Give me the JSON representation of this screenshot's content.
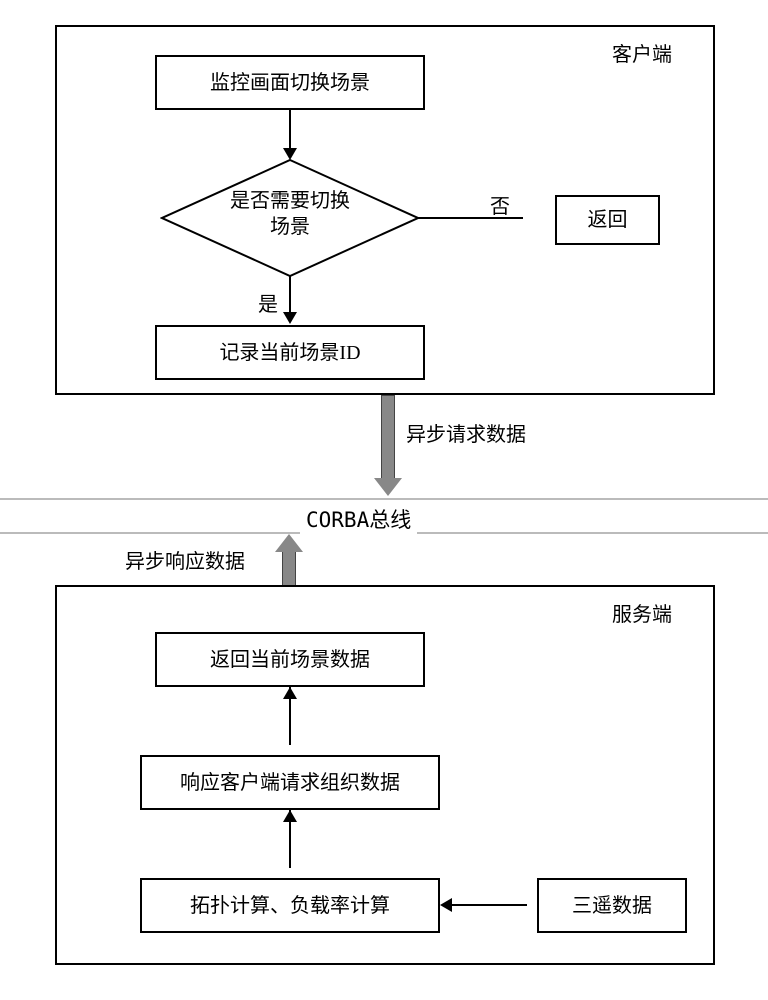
{
  "chart_data": {
    "type": "flowchart",
    "client": {
      "title": "客户端",
      "start": "监控画面切换场景",
      "decision": "是否需要切换\n场景",
      "decision_yes": "是",
      "decision_no": "否",
      "return_box": "返回",
      "record_id": "记录当前场景ID"
    },
    "bus": {
      "async_request": "异步请求数据",
      "bus_label": "CORBA总线",
      "async_response": "异步响应数据"
    },
    "server": {
      "title": "服务端",
      "return_scene": "返回当前场景数据",
      "respond_client": "响应客户端请求组织数据",
      "topology": "拓扑计算、负载率计算",
      "telemetry": "三遥数据"
    }
  }
}
